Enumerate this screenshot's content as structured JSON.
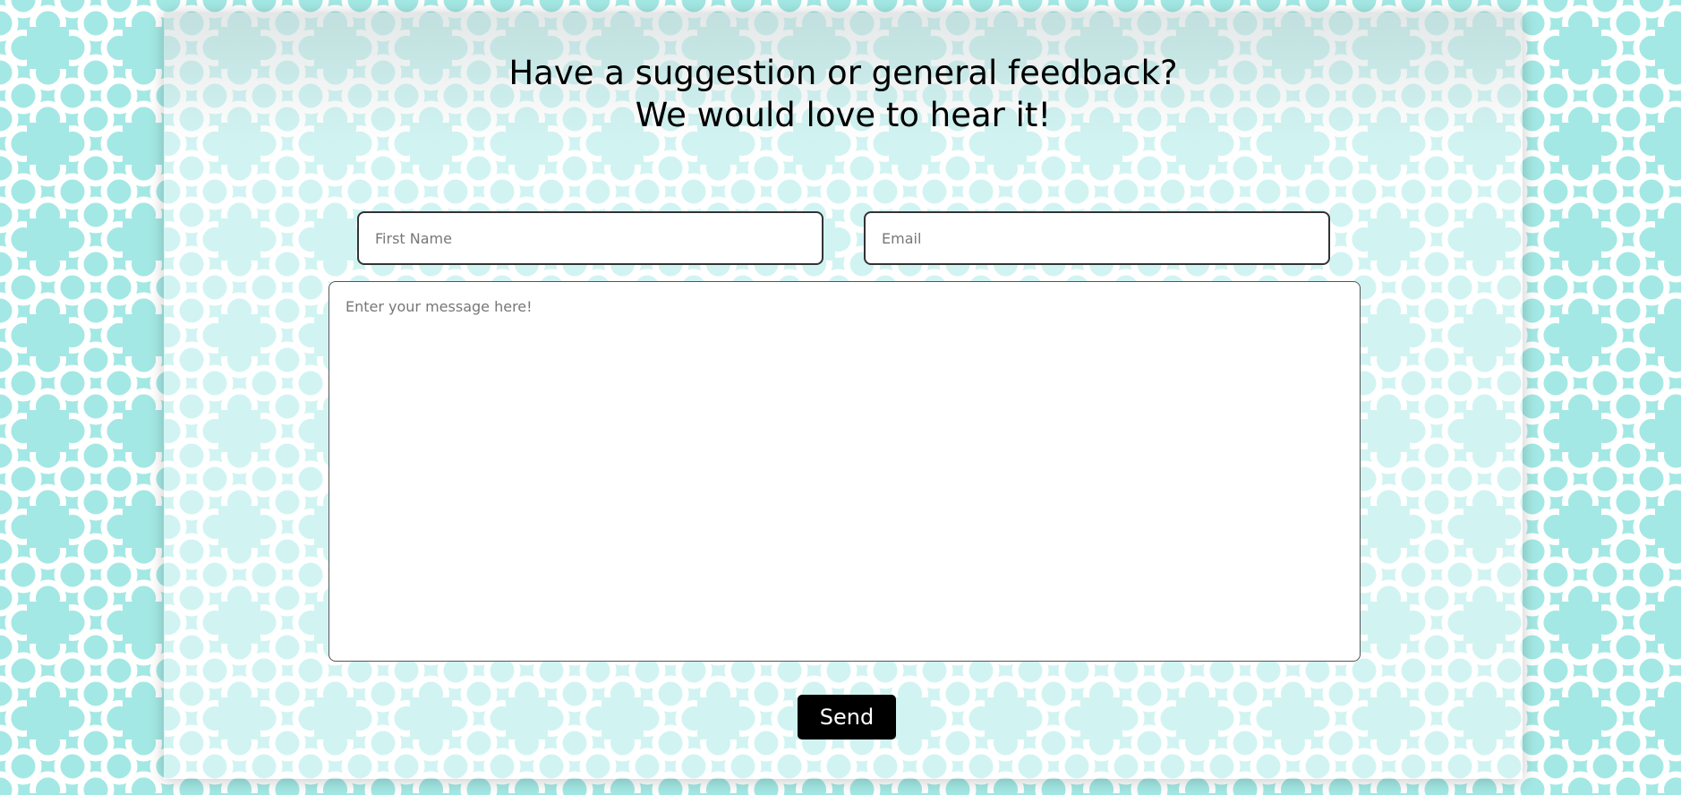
{
  "colors": {
    "background": "#a3e8e4",
    "pattern_lines": "#ffffff",
    "card_overlay": "#ffffff",
    "button_bg": "#000000",
    "button_text": "#ffffff"
  },
  "form": {
    "heading_line1": "Have a suggestion or general feedback?",
    "heading_line2": "We would love to hear it!",
    "first_name_placeholder": "First Name",
    "email_placeholder": "Email",
    "message_placeholder": "Enter your message here!",
    "send_label": "Send"
  }
}
